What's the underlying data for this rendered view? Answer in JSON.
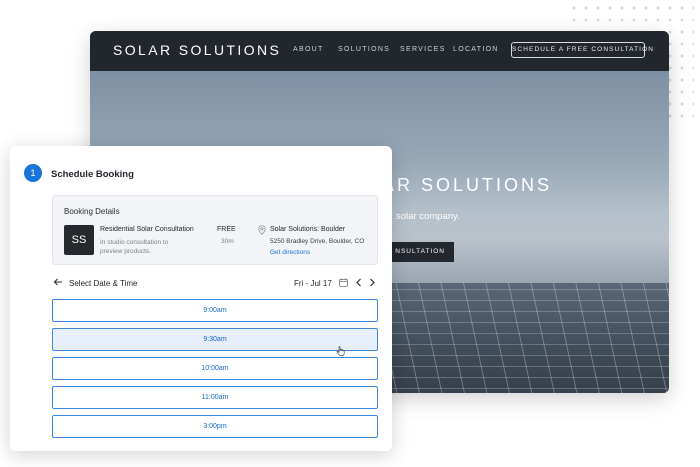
{
  "site": {
    "brand": "SOLAR SOLUTIONS",
    "nav": [
      "ABOUT",
      "SOLUTIONS",
      "SERVICES",
      "LOCATION"
    ],
    "cta": "SCHEDULE A FREE CONSULTATION",
    "hero_title": "AR SOLUTIONS",
    "hero_subtitle": "solar company.",
    "hero_button": "NSULTATION"
  },
  "booking": {
    "step": "1",
    "title": "Schedule Booking",
    "details_title": "Booking Details",
    "avatar": "SS",
    "service_name": "Residential Solar Consultation",
    "service_desc": "In studio consultation to preview products.",
    "price": "FREE",
    "duration": "30m",
    "location_name": "Solar Solutions: Boulder",
    "location_address": "5250 Bradley Drive, Boulder, CO",
    "directions": "Get directions",
    "select_label": "Select Date & Time",
    "date": "Fri - Jul 17",
    "slots": [
      "9:00am",
      "9:30am",
      "10:00am",
      "11:00am",
      "3:00pm"
    ],
    "selected_slot": "9:30am"
  },
  "colors": {
    "accent": "#1a73d9",
    "nav_bg": "#22262d",
    "slot_selected_bg": "#e6effb"
  }
}
